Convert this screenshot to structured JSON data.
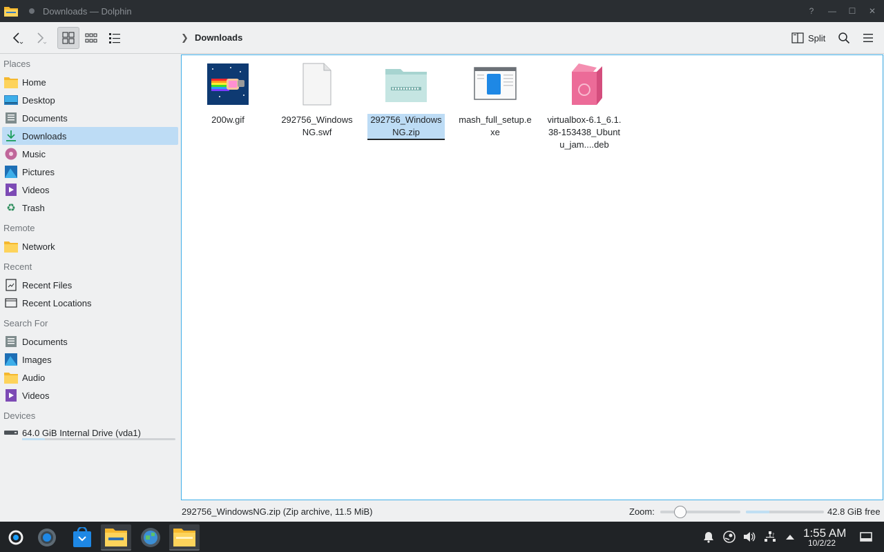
{
  "window": {
    "title": "Downloads — Dolphin",
    "controls": [
      "?",
      "—",
      "☐",
      "✕"
    ]
  },
  "toolbar": {
    "breadcrumb": "Downloads",
    "split_label": "Split"
  },
  "sidebar": {
    "sections": [
      {
        "title": "Places",
        "items": [
          "Home",
          "Desktop",
          "Documents",
          "Downloads",
          "Music",
          "Pictures",
          "Videos",
          "Trash"
        ]
      },
      {
        "title": "Remote",
        "items": [
          "Network"
        ]
      },
      {
        "title": "Recent",
        "items": [
          "Recent Files",
          "Recent Locations"
        ]
      },
      {
        "title": "Search For",
        "items": [
          "Documents",
          "Images",
          "Audio",
          "Videos"
        ]
      },
      {
        "title": "Devices",
        "items": [
          "64.0 GiB Internal Drive (vda1)"
        ]
      }
    ],
    "selected": "Downloads"
  },
  "files": [
    {
      "name": "200w.gif",
      "icon": "gif-thumbnail"
    },
    {
      "name": "292756_WindowsNG.swf",
      "icon": "generic-file-icon"
    },
    {
      "name": "292756_WindowsNG.zip",
      "icon": "zip-archive-icon",
      "selected": true
    },
    {
      "name": "mash_full_setup.exe",
      "icon": "exe-window-icon"
    },
    {
      "name": "virtualbox-6.1_6.1.38-153438_Ubuntu_jam....deb",
      "icon": "deb-package-icon"
    }
  ],
  "statusbar": {
    "selection_info": "292756_WindowsNG.zip (Zip archive, 11.5 MiB)",
    "zoom_label": "Zoom:",
    "zoom_level": 0.2,
    "free_space": "42.8 GiB free",
    "used_fraction": 0.3
  },
  "taskbar": {
    "time": "1:55 AM",
    "date": "10/2/22"
  },
  "colors": {
    "selection": "#bddcf5",
    "accent": "#3daee9",
    "taskbar": "#202326",
    "titlebar": "#2a2e32"
  }
}
